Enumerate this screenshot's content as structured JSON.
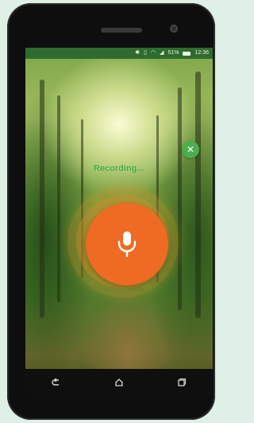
{
  "status_bar": {
    "battery_text": "51%",
    "time": "12:36",
    "icons": [
      "bluetooth-icon",
      "vibrate-icon",
      "wifi-icon",
      "signal-icon",
      "battery-icon"
    ]
  },
  "recording": {
    "label": "Recording..."
  },
  "close_button": {
    "icon": "close-icon",
    "glyph": "✕"
  },
  "mic_button": {
    "icon": "microphone-icon"
  },
  "nav_bar": {
    "items": [
      "back-icon",
      "home-icon",
      "recents-icon"
    ]
  },
  "colors": {
    "status_bar": "#2e6b2e",
    "accent_green": "#3fae3c",
    "mic_orange": "#ef6a22",
    "close_green": "#4cae4c"
  }
}
